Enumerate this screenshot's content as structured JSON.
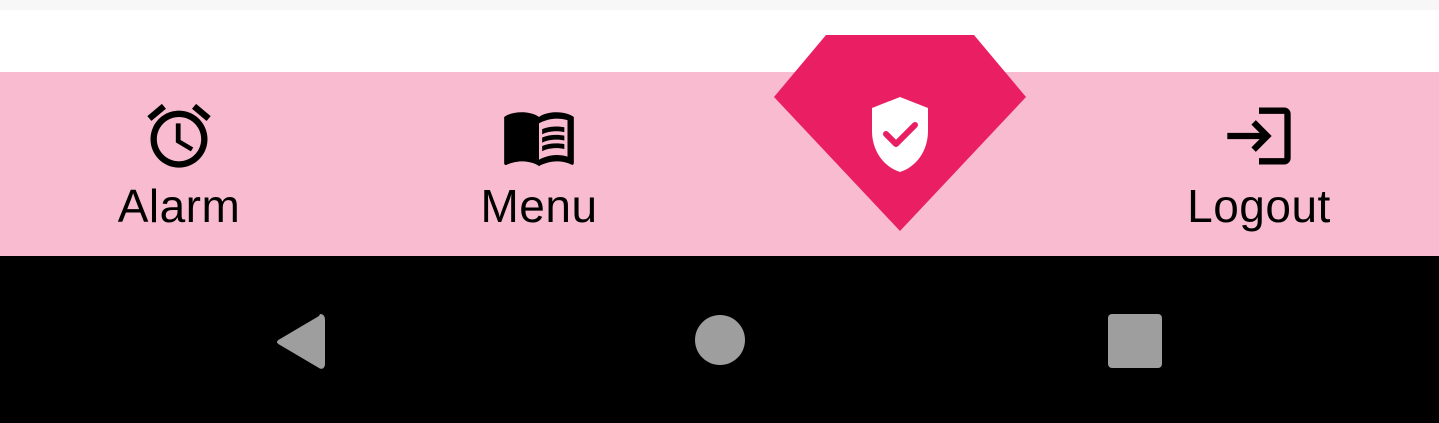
{
  "bottom_nav": {
    "items": [
      {
        "label": "Alarm",
        "icon": "alarm-clock-icon"
      },
      {
        "label": "Menu",
        "icon": "open-book-icon"
      },
      {
        "label": "Logout",
        "icon": "login-arrow-icon"
      }
    ],
    "center_action": {
      "icon": "shield-check-icon"
    }
  },
  "system_nav": {
    "buttons": [
      "back-icon",
      "home-icon",
      "recents-icon"
    ]
  },
  "colors": {
    "nav_background": "#f8bbd0",
    "accent": "#e91e63",
    "system_bar": "#000000",
    "system_icon": "#9e9e9e"
  }
}
